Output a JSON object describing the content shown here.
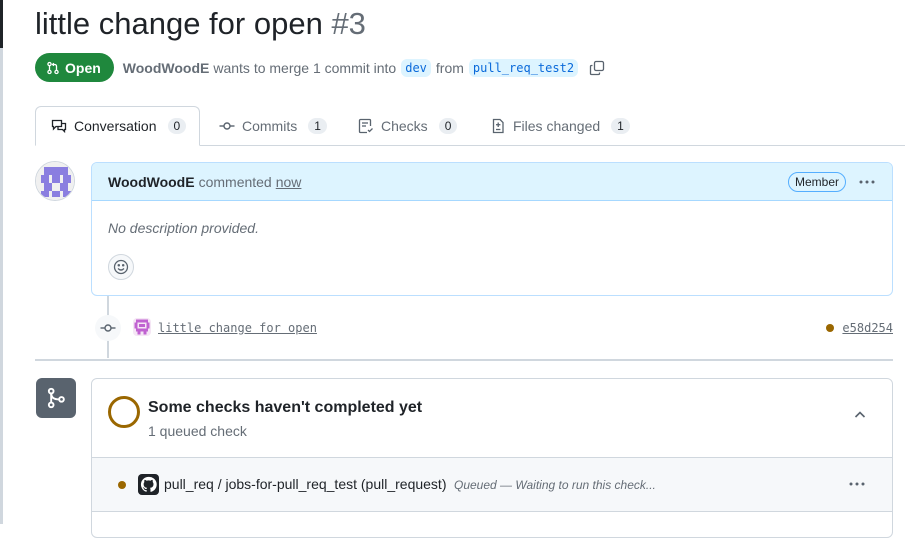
{
  "pr": {
    "title": "little change for open",
    "number": "#3",
    "state": "Open",
    "author": "WoodWoodE",
    "merge_text": "wants to merge 1 commit into",
    "base_branch": "dev",
    "from_text": "from",
    "head_branch": "pull_req_test2"
  },
  "tabs": [
    {
      "label": "Conversation",
      "count": "0",
      "icon": "comment-discussion-icon"
    },
    {
      "label": "Commits",
      "count": "1",
      "icon": "git-commit-icon"
    },
    {
      "label": "Checks",
      "count": "0",
      "icon": "checklist-icon"
    },
    {
      "label": "Files changed",
      "count": "1",
      "icon": "file-diff-icon"
    }
  ],
  "comment": {
    "author": "WoodWoodE",
    "action": "commented",
    "time": "now",
    "role_badge": "Member",
    "body": "No description provided."
  },
  "commit": {
    "message": "little change for open",
    "sha": "e58d254"
  },
  "checks": {
    "title": "Some checks haven't completed yet",
    "subtitle": "1 queued check",
    "rows": [
      {
        "name": "pull_req / jobs-for-pull_req_test (pull_request)",
        "status": "Queued — Waiting to run this check..."
      }
    ]
  },
  "colors": {
    "open_green": "#1f883d",
    "accent_blue": "#0969da",
    "pending": "#9a6700",
    "comment_header_bg": "#ddf4ff"
  }
}
